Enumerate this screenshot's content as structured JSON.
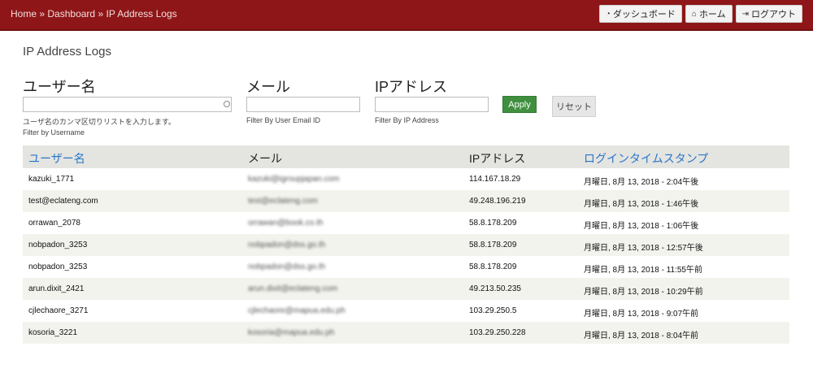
{
  "breadcrumb": {
    "items": [
      "Home",
      "Dashboard",
      "IP Address Logs"
    ],
    "separator": "»"
  },
  "topbar_buttons": [
    {
      "icon": "dashboard-icon",
      "glyph": "◔",
      "label": "ダッシュボード"
    },
    {
      "icon": "home-icon",
      "glyph": "⌂",
      "label": "ホーム"
    },
    {
      "icon": "logout-icon",
      "glyph": "⇥",
      "label": "ログアウト"
    }
  ],
  "page_title": "IP Address Logs",
  "filters": {
    "username": {
      "label": "ユーザー名",
      "value": "",
      "help_ja": "ユーザ名のカンマ区切りリストを入力します。",
      "help_en": "Filter by Username"
    },
    "email": {
      "label": "メール",
      "value": "",
      "help": "Filter By User Email ID"
    },
    "ip": {
      "label": "IPアドレス",
      "value": "",
      "help": "Filter By IP Address"
    },
    "apply_label": "Apply",
    "reset_label": "リセット"
  },
  "table": {
    "headers": [
      "ユーザー名",
      "メール",
      "IPアドレス",
      "ログインタイムスタンプ"
    ],
    "rows": [
      {
        "user": "kazuki_1771",
        "email": "kazuki@igroupjapan.com",
        "ip": "114.167.18.29",
        "time": "月曜日, 8月 13, 2018 - 2:04午後"
      },
      {
        "user": "test@eclateng.com",
        "email": "test@eclateng.com",
        "ip": "49.248.196.219",
        "time": "月曜日, 8月 13, 2018 - 1:46午後"
      },
      {
        "user": "orrawan_2078",
        "email": "orrawan@book.co.th",
        "ip": "58.8.178.209",
        "time": "月曜日, 8月 13, 2018 - 1:06午後"
      },
      {
        "user": "nobpadon_3253",
        "email": "nobpadon@dss.go.th",
        "ip": "58.8.178.209",
        "time": "月曜日, 8月 13, 2018 - 12:57午後"
      },
      {
        "user": "nobpadon_3253",
        "email": "nobpadon@dss.go.th",
        "ip": "58.8.178.209",
        "time": "月曜日, 8月 13, 2018 - 11:55午前"
      },
      {
        "user": "arun.dixit_2421",
        "email": "arun.dixit@eclateng.com",
        "ip": "49.213.50.235",
        "time": "月曜日, 8月 13, 2018 - 10:29午前"
      },
      {
        "user": "cjlechaore_3271",
        "email": "cjlechaore@mapua.edu.ph",
        "ip": "103.29.250.5",
        "time": "月曜日, 8月 13, 2018 - 9:07午前"
      },
      {
        "user": "kosoria_3221",
        "email": "kosoria@mapua.edu.ph",
        "ip": "103.29.250.228",
        "time": "月曜日, 8月 13, 2018 - 8:04午前"
      }
    ]
  },
  "colors": {
    "header_bg": "#8e1618",
    "link": "#2a77c9",
    "apply_bg": "#3f8f3f"
  }
}
